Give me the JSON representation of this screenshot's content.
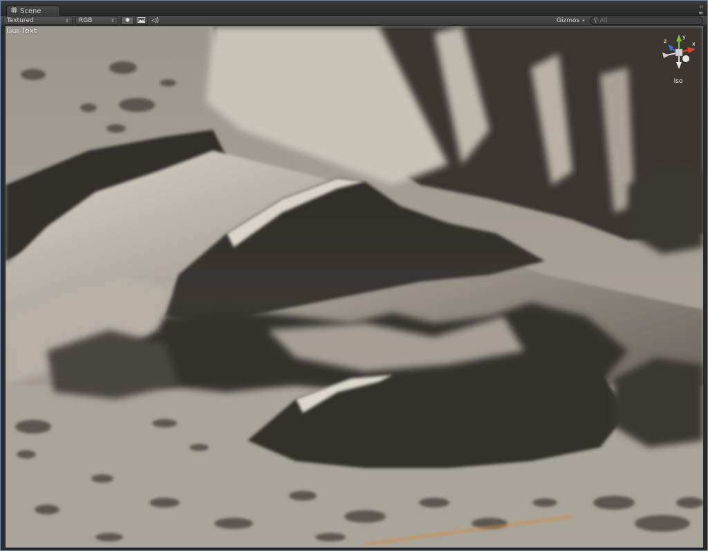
{
  "window": {
    "tab_title": "Scene",
    "tab_icon": "scene-grid-icon",
    "window_icons": [
      "maximize-icon",
      "menu-icon"
    ]
  },
  "toolbar": {
    "render_mode": "Textured",
    "color_mode": "RGB",
    "lighting_icon": "sun-icon",
    "image_icon": "image-icon",
    "audio_icon": "speaker-icon",
    "gizmos_label": "Gizmos",
    "search_placeholder": "All",
    "search_icon": "search-icon"
  },
  "viewport": {
    "gui_text": "Gui Text",
    "projection_label": "Iso",
    "axis_labels": {
      "x": "x",
      "y": "y",
      "z": "z"
    },
    "axis_colors": {
      "x": "#e0422b",
      "y": "#7cc23a",
      "z": "#3a6fd8"
    }
  }
}
